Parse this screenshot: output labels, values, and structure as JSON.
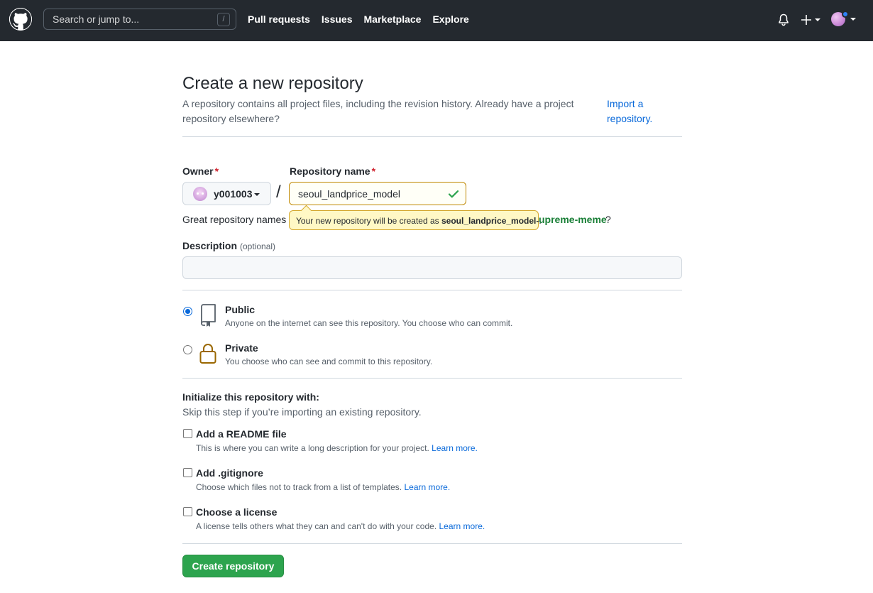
{
  "header": {
    "search_placeholder": "Search or jump to...",
    "search_shortcut": "/",
    "nav": [
      "Pull requests",
      "Issues",
      "Marketplace",
      "Explore"
    ]
  },
  "page": {
    "title": "Create a new repository",
    "description": "A repository contains all project files, including the revision history. Already have a project repository elsewhere?",
    "import_link": "Import a repository."
  },
  "form": {
    "owner_label": "Owner",
    "required_mark": "*",
    "owner_value": "y001003",
    "separator": "/",
    "repo_name_label": "Repository name",
    "repo_name_value": "seoul_landprice_model",
    "great_names_text": "Great repository names a",
    "suggestion_name": "upreme-meme",
    "suggestion_suffix": "?",
    "tooltip_prefix": "Your new repository will be created as ",
    "tooltip_name": "seoul_landprice_model-",
    "tooltip_suffix": ".",
    "description_label": "Description",
    "description_optional": "(optional)",
    "description_value": ""
  },
  "visibility": {
    "selected": "public",
    "public_title": "Public",
    "public_desc": "Anyone on the internet can see this repository. You choose who can commit.",
    "private_title": "Private",
    "private_desc": "You choose who can see and commit to this repository."
  },
  "init": {
    "title": "Initialize this repository with:",
    "subtitle": "Skip this step if you’re importing an existing repository.",
    "options": [
      {
        "title": "Add a README file",
        "desc": "This is where you can write a long description for your project.",
        "link": "Learn more.",
        "checked": false
      },
      {
        "title": "Add .gitignore",
        "desc": "Choose which files not to track from a list of templates.",
        "link": "Learn more.",
        "checked": false
      },
      {
        "title": "Choose a license",
        "desc": "A license tells others what they can and can't do with your code.",
        "link": "Learn more.",
        "checked": false
      }
    ]
  },
  "submit_label": "Create repository",
  "colors": {
    "header_bg": "#24292f",
    "link": "#0969da",
    "primary_button": "#2da44e",
    "tooltip_bg": "#fff8c5",
    "success": "#1a7f37"
  }
}
